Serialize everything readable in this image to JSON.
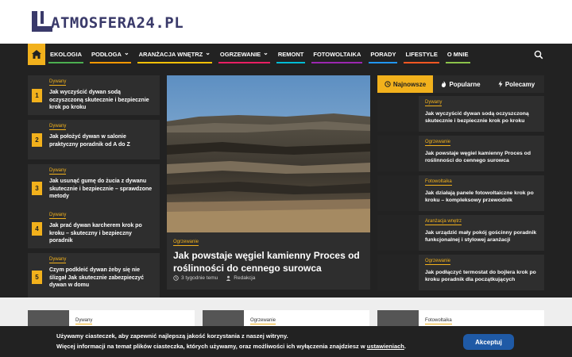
{
  "site": {
    "logo_text": "ATMOSFERA24.PL"
  },
  "nav": {
    "items": [
      {
        "label": "EKOLOGIA",
        "color": "#4caf50"
      },
      {
        "label": "PODŁOGA",
        "color": "#ff9800",
        "has_dropdown": true
      },
      {
        "label": "ARANŻACJA WNĘTRZ",
        "color": "#ffc107",
        "has_dropdown": true
      },
      {
        "label": "OGRZEWANIE",
        "color": "#e91e63",
        "has_dropdown": true
      },
      {
        "label": "REMONT",
        "color": "#00bcd4"
      },
      {
        "label": "FOTOWOLTAIKA",
        "color": "#9c27b0"
      },
      {
        "label": "PORADY",
        "color": "#2196f3"
      },
      {
        "label": "LIFESTYLE",
        "color": "#ff5722"
      },
      {
        "label": "O MNIE",
        "color": "#8bc34a"
      }
    ],
    "dropdown_glyph": "⌄"
  },
  "ranked": [
    {
      "num": "1",
      "category": "Dywany",
      "title": "Jak wyczyścić dywan sodą oczyszczoną skutecznie i bezpiecznie krok po kroku"
    },
    {
      "num": "2",
      "category": "Dywany",
      "title": "Jak położyć dywan w salonie praktyczny poradnik od A do Z"
    },
    {
      "num": "3",
      "category": "Dywany",
      "title": "Jak usunąć gumę do żucia z dywanu skutecznie i bezpiecznie – sprawdzone metody"
    },
    {
      "num": "4",
      "category": "Dywany",
      "title": "Jak prać dywan karcherem krok po kroku – skuteczny i bezpieczny poradnik"
    },
    {
      "num": "5",
      "category": "Dywany",
      "title": "Czym podkleić dywan żeby się nie ślizgał Jak skutecznie zabezpieczyć dywan w domu"
    }
  ],
  "featured": {
    "category": "Ogrzewanie",
    "title": "Jak powstaje węgiel kamienny Proces od roślinności do cennego surowca",
    "time": "3 tygodnie temu",
    "author": "Redakcja"
  },
  "tabs": [
    {
      "label": "Najnowsze",
      "icon": "clock-icon",
      "active": true
    },
    {
      "label": "Popularne",
      "icon": "flame-icon",
      "active": false
    },
    {
      "label": "Polecamy",
      "icon": "bolt-icon",
      "active": false
    }
  ],
  "sidebar_posts": [
    {
      "category": "Dywany",
      "title": "Jak wyczyścić dywan sodą oczyszczoną skutecznie i bezpiecznie krok po kroku"
    },
    {
      "category": "Ogrzewanie",
      "title": "Jak powstaje węgiel kamienny Proces od roślinności do cennego surowca"
    },
    {
      "category": "Fotowoltaika",
      "title": "Jak działają panele fotowoltaiczne krok po kroku – kompleksowy przewodnik"
    },
    {
      "category": "Aranżacja wnętrz",
      "title": "Jak urządzić mały pokój gościnny poradnik funkcjonalnej i stylowej aranżacji"
    },
    {
      "category": "Ogrzewanie",
      "title": "Jak podłączyć termostat do bojlera krok po kroku poradnik dla początkujących"
    }
  ],
  "bottom_cards": [
    {
      "category": "Dywany"
    },
    {
      "category": "Ogrzewanie"
    },
    {
      "category": "Fotowoltaika"
    }
  ],
  "cookie": {
    "line1": "Używamy ciasteczek, aby zapewnić najlepszą jakość korzystania z naszej witryny.",
    "line2_prefix": "Więcej informacji na temat plików ciasteczka, których używamy, oraz możliwości ich wyłączenia znajdziesz w ",
    "line2_link": "ustawieniach",
    "line2_suffix": ".",
    "accept": "Akceptuj"
  },
  "colors": {
    "accent": "#f2b11c",
    "dark_bg": "#222222",
    "card_bg": "#2e2e2e",
    "button": "#1f5aa6"
  }
}
